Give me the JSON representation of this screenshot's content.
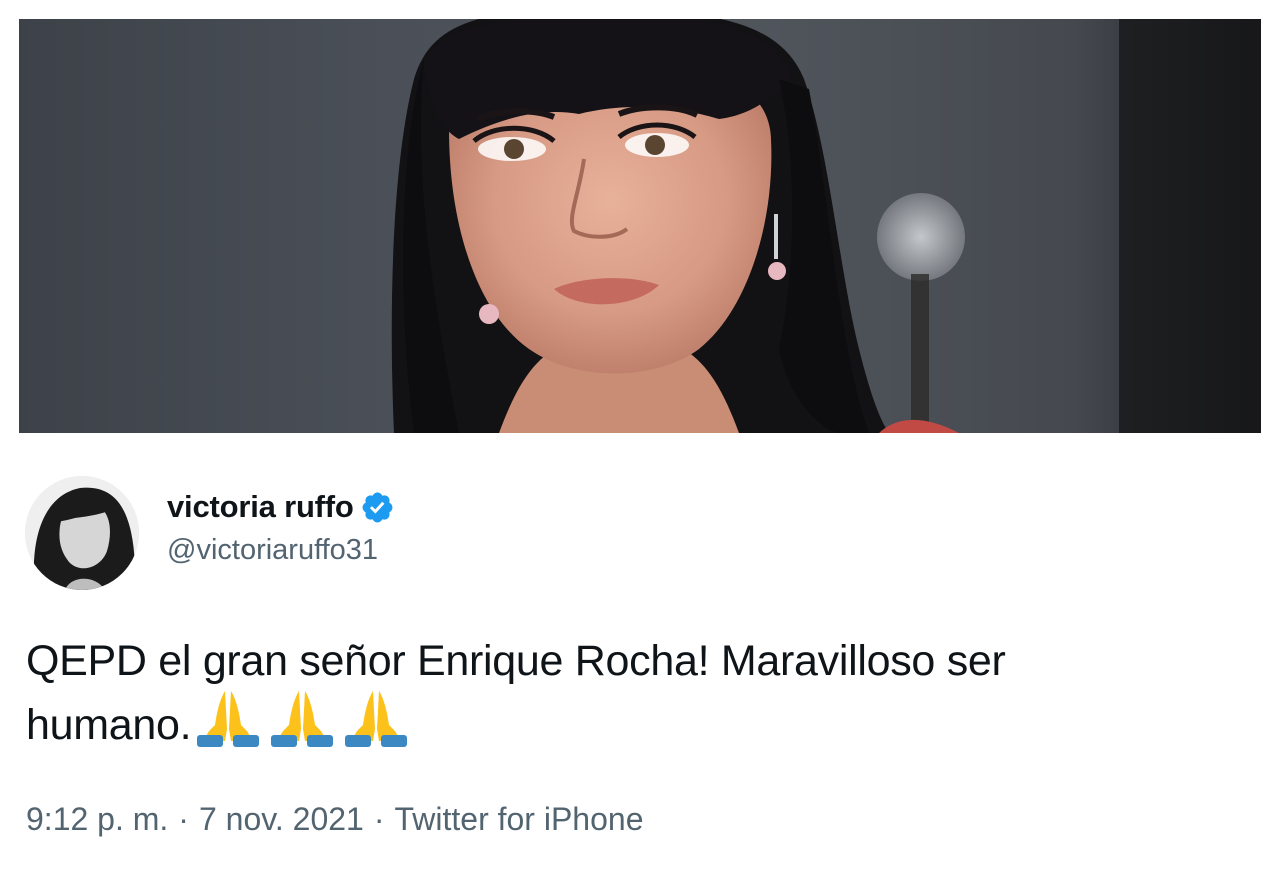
{
  "tweet": {
    "display_name": "victoria ruffo",
    "handle": "@victoriaruffo31",
    "verified": true,
    "text_line1": "QEPD el gran señor Enrique Rocha! Maravilloso ser",
    "text_line2": "humano.",
    "emoji": [
      "folded-hands",
      "folded-hands",
      "folded-hands"
    ],
    "time": "9:12 p. m.",
    "separator": "·",
    "date": "7 nov. 2021",
    "source": "Twitter for iPhone"
  },
  "colors": {
    "text_primary": "#0f1419",
    "text_secondary": "#536471",
    "verified_blue": "#1d9bf0",
    "background": "#ffffff"
  }
}
